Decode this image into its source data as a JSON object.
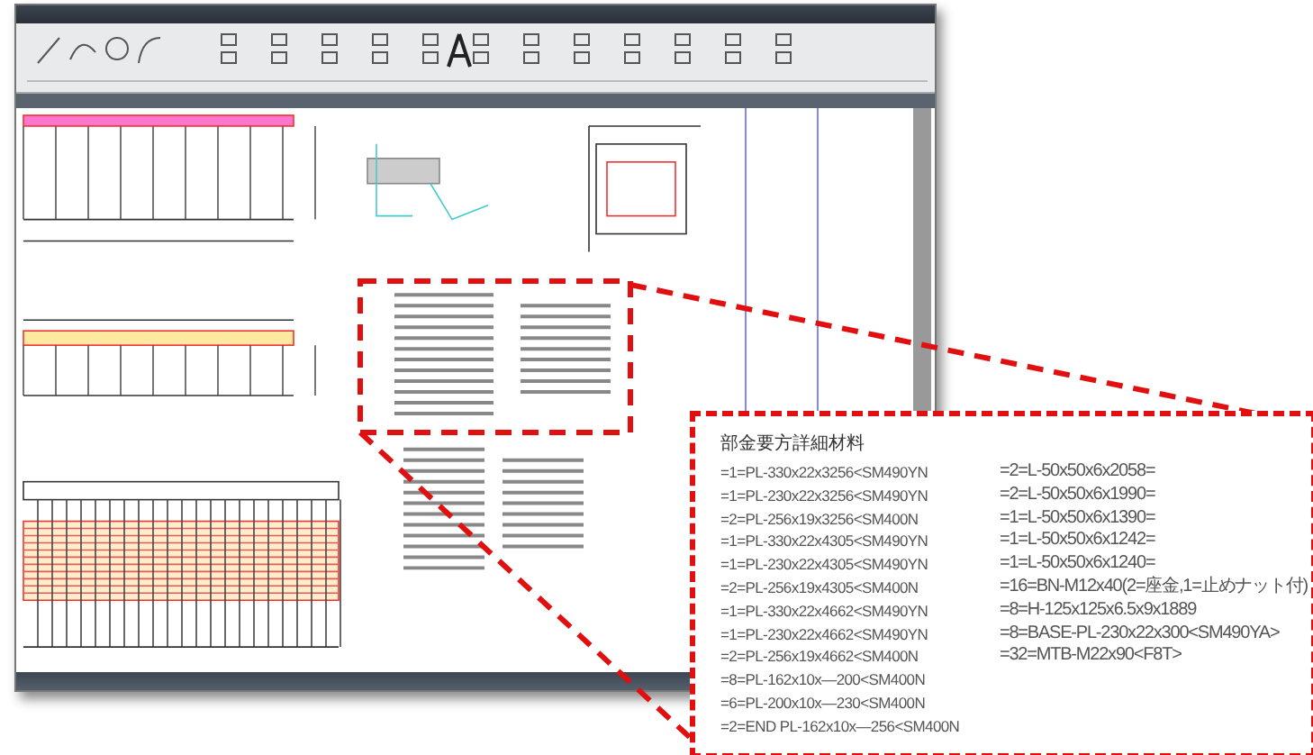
{
  "callout": {
    "title": "部金要方詳細材料",
    "left_items": [
      "=1=PL-330x22x3256<SM490YN",
      "=1=PL-230x22x3256<SM490YN",
      "=2=PL-256x19x3256<SM400N",
      "=1=PL-330x22x4305<SM490YN",
      "=1=PL-230x22x4305<SM490YN",
      "=2=PL-256x19x4305<SM400N",
      "=1=PL-330x22x4662<SM490YN",
      "=1=PL-230x22x4662<SM490YN",
      "=2=PL-256x19x4662<SM400N",
      "=8=PL-162x10x—200<SM400N",
      "=6=PL-200x10x—230<SM400N",
      "=2=END PL-162x10x—256<SM400N"
    ],
    "right_items": [
      "=2=L-50x50x6x2058=",
      "=2=L-50x50x6x1990=",
      "=1=L-50x50x6x1390=",
      "=1=L-50x50x6x1242=",
      "=1=L-50x50x6x1240=",
      "=16=BN-M12x40(2=座金,1=止めナット付)",
      "=8=H-125x125x6.5x9x1889",
      "=8=BASE-PL-230x22x300<SM490YA>",
      "=32=MTB-M22x90<F8T>"
    ]
  }
}
